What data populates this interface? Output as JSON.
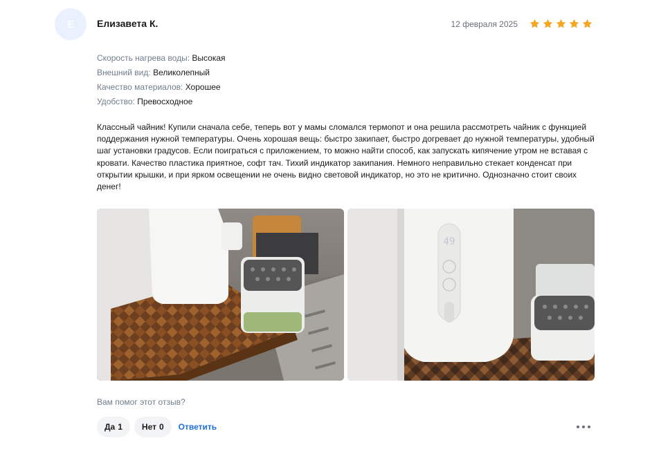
{
  "review": {
    "avatar_letter": "Е",
    "author": "Елизавета К.",
    "date": "12 февраля 2025",
    "rating": 5,
    "rating_max": 5,
    "star_color": "#f5a623",
    "attributes": [
      {
        "label": "Скорость нагрева воды:",
        "value": "Высокая"
      },
      {
        "label": "Внешний вид:",
        "value": "Великолепный"
      },
      {
        "label": "Качество материалов:",
        "value": "Хорошее"
      },
      {
        "label": "Удобство:",
        "value": "Превосходное"
      }
    ],
    "text": "Классный чайник! Купили сначала себе, теперь вот у мамы сломался термопот и она решила рассмотреть чайник с функцией поддержания нужной температуры. Очень хорошая вещь: быстро закипает, быстро догревает до нужной температуры, удобный шаг установки градусов. Если поиграться с приложением, то можно найти способ, как запускать кипячение утром не вставая с кровати. Качество пластика приятное, софт тач. Тихий индикатор закипания. Немного неправильно стекает конденсат при открытии крышки, и при ярком освещении не очень видно световой индикатор, но это не критично. Однозначно стоит своих денег!",
    "photos": [
      {
        "icon": "photo-kettle-on-cutting-board"
      },
      {
        "icon": "photo-kettle-display-closeup",
        "display_reading": "49"
      }
    ]
  },
  "feedback": {
    "question": "Вам помог этот отзыв?",
    "yes_label": "Да",
    "yes_count": "1",
    "no_label": "Нет",
    "no_count": "0",
    "reply_label": "Ответить",
    "more_icon": "more-horizontal-icon"
  },
  "colors": {
    "accent": "#1d6fd8",
    "muted": "#6f7d8c",
    "pill_bg": "#f2f3f5",
    "avatar_bg": "#e8f1fd"
  }
}
